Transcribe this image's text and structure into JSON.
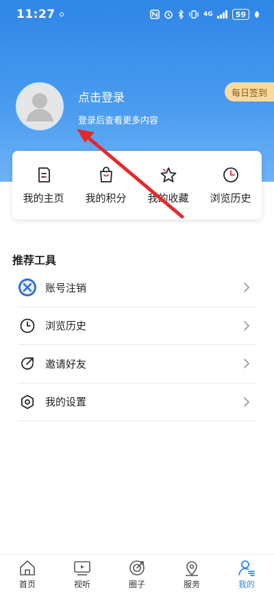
{
  "status_bar": {
    "time": "11:27",
    "signal": "4G",
    "battery": "59"
  },
  "profile": {
    "login_title": "点击登录",
    "login_subtitle": "登录后查看更多内容",
    "daily_signin": "每日签到"
  },
  "quick_links": [
    {
      "label": "我的主页",
      "icon": "note-icon"
    },
    {
      "label": "我的积分",
      "icon": "shopping-bag-icon"
    },
    {
      "label": "我的收藏",
      "icon": "star-icon"
    },
    {
      "label": "浏览历史",
      "icon": "clock-icon"
    }
  ],
  "tools": {
    "title": "推荐工具",
    "items": [
      {
        "label": "账号注销",
        "icon": "cancel-account-icon"
      },
      {
        "label": "浏览历史",
        "icon": "clock-icon"
      },
      {
        "label": "邀请好友",
        "icon": "share-icon"
      },
      {
        "label": "我的设置",
        "icon": "settings-icon"
      }
    ]
  },
  "tabbar": [
    {
      "label": "首页",
      "icon": "home-icon"
    },
    {
      "label": "视听",
      "icon": "tv-icon"
    },
    {
      "label": "圈子",
      "icon": "compass-icon"
    },
    {
      "label": "服务",
      "icon": "location-icon"
    },
    {
      "label": "我的",
      "icon": "profile-icon",
      "active": true
    }
  ],
  "colors": {
    "accent": "#2f86e6",
    "signin_bg": "#f8d9a0",
    "arrow": "#e8262b"
  }
}
